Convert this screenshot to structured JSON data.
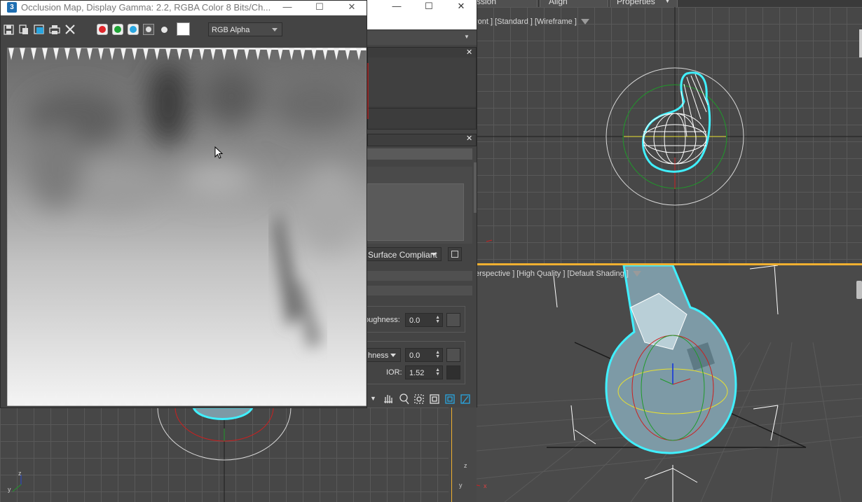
{
  "menu": {
    "item1": "ssion",
    "item2": "Align",
    "item3": "Properties"
  },
  "viewport_front": {
    "label": "[ Front ] [ Standard ] [ Wireframe ]",
    "label_visible": "ront ] [Standard ] [Wireframe ]"
  },
  "viewport_perspective": {
    "label": "erspective ] [High Quality ] [Default Shading ]"
  },
  "frame_window": {
    "title": "Occlusion Map, Display Gamma: 2.2, RGBA Color 8 Bits/Ch...",
    "app_icon": "3",
    "channel_select": "RGB Alpha",
    "toolbar_icons": [
      "save-icon",
      "copy-icon",
      "clone-icon",
      "print-icon",
      "clear-icon"
    ],
    "channel_colors": [
      "#e0262b",
      "#1fa436",
      "#2aa6e0"
    ]
  },
  "material_panel": {
    "preset_select": "Surface Compliant",
    "roughness_label": "oughness:",
    "roughness_value": "0.0",
    "roughness2_label": "hness",
    "roughness2_value": "0.0",
    "ior_label": "IOR:",
    "ior_value": "1.52"
  },
  "axis": {
    "x": "x",
    "y": "y",
    "z": "z"
  },
  "colors": {
    "selection_cyan": "#40f0ff",
    "accent_orange": "#f0b030",
    "viewport_bg": "#474747"
  }
}
